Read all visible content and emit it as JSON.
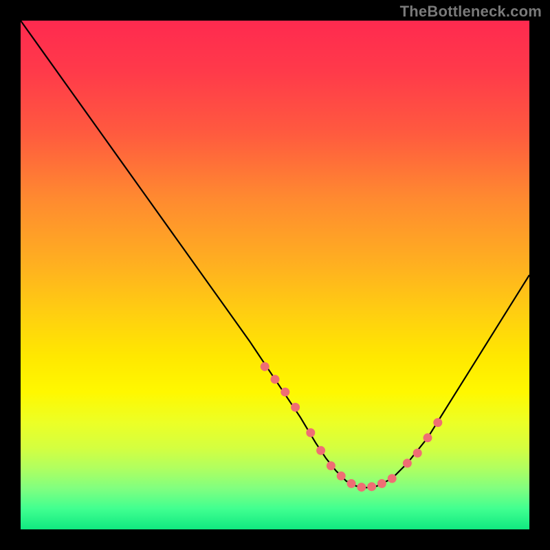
{
  "attribution": "TheBottleneck.com",
  "chart_data": {
    "type": "line",
    "title": "",
    "xlabel": "",
    "ylabel": "",
    "xlim": [
      0,
      100
    ],
    "ylim": [
      0,
      100
    ],
    "curve": {
      "name": "bottleneck-curve",
      "x": [
        0,
        5,
        10,
        15,
        20,
        25,
        30,
        35,
        40,
        45,
        50,
        55,
        58,
        60,
        62,
        64,
        66,
        68,
        70,
        73,
        76,
        80,
        85,
        90,
        95,
        100
      ],
      "y": [
        100,
        93,
        86,
        79,
        72,
        65,
        58,
        51,
        44,
        37,
        29.5,
        22,
        17,
        14,
        11.5,
        9.5,
        8.5,
        8.2,
        8.5,
        10,
        13,
        18,
        26,
        34,
        42,
        50
      ]
    },
    "markers": {
      "name": "highlight-points",
      "style": "circle",
      "color": "#ef6e74",
      "x": [
        48,
        50,
        52,
        54,
        57,
        59,
        61,
        63,
        65,
        67,
        69,
        71,
        73,
        76,
        78,
        80,
        82
      ],
      "y": [
        32,
        29.5,
        27,
        24,
        19,
        15.5,
        12.5,
        10.5,
        9,
        8.3,
        8.4,
        9,
        10,
        13,
        15,
        18,
        21
      ]
    }
  }
}
